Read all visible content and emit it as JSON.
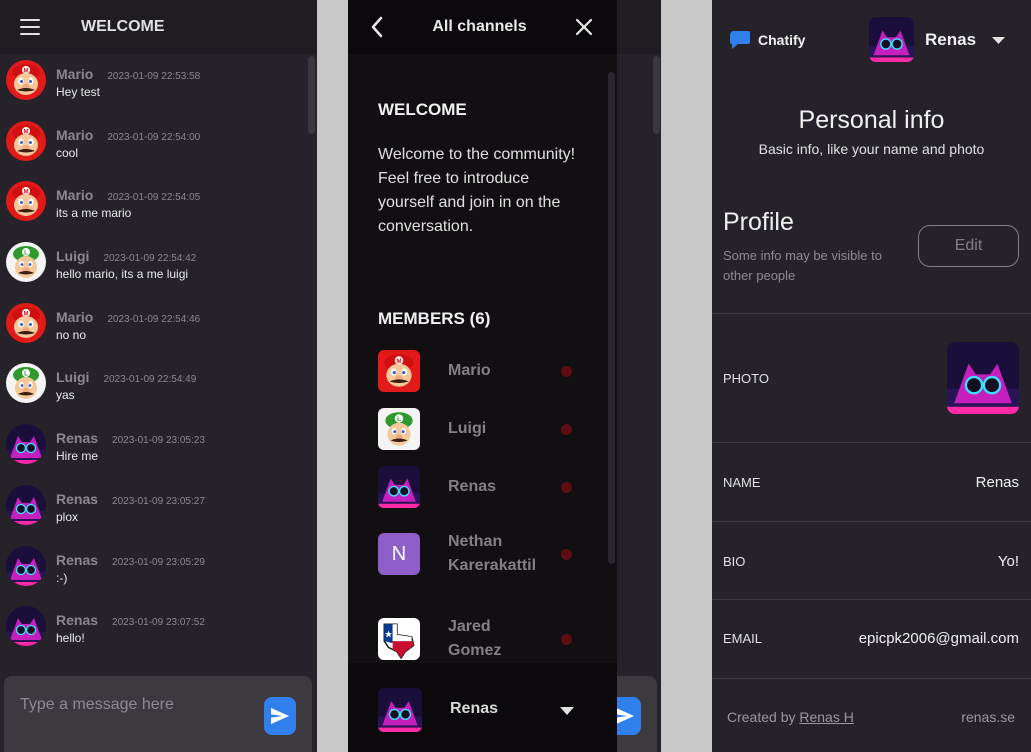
{
  "chat": {
    "channel_title": "WELCOME",
    "messages": [
      {
        "name": "Mario",
        "time": "2023-01-09 22:53:58",
        "text": "Hey test",
        "avatar": "mario"
      },
      {
        "name": "Mario",
        "time": "2023-01-09 22:54:00",
        "text": "cool",
        "avatar": "mario"
      },
      {
        "name": "Mario",
        "time": "2023-01-09 22:54:05",
        "text": "its a me mario",
        "avatar": "mario"
      },
      {
        "name": "Luigi",
        "time": "2023-01-09 22:54:42",
        "text": "hello mario, its a me luigi",
        "avatar": "luigi"
      },
      {
        "name": "Mario",
        "time": "2023-01-09 22:54:46",
        "text": "no no",
        "avatar": "mario"
      },
      {
        "name": "Luigi",
        "time": "2023-01-09 22:54:49",
        "text": "yas",
        "avatar": "luigi"
      },
      {
        "name": "Renas",
        "time": "2023-01-09 23:05:23",
        "text": "Hire me",
        "avatar": "renas"
      },
      {
        "name": "Renas",
        "time": "2023-01-09 23:05:27",
        "text": "plox",
        "avatar": "renas"
      },
      {
        "name": "Renas",
        "time": "2023-01-09 23:05:29",
        "text": ":-)",
        "avatar": "renas"
      },
      {
        "name": "Renas",
        "time": "2023-01-09 23:07:52",
        "text": "hello!",
        "avatar": "renas"
      }
    ],
    "composer": {
      "placeholder": "Type a message here"
    }
  },
  "drawer": {
    "title": "All channels",
    "channel_name": "WELCOME",
    "description": "Welcome to the community! Feel free to introduce yourself and join in on the conversation.",
    "members_heading": "MEMBERS (6)",
    "members": [
      {
        "name": "Mario",
        "avatar": "mario",
        "status": "offline"
      },
      {
        "name": "Luigi",
        "avatar": "luigi",
        "status": "offline"
      },
      {
        "name": "Renas",
        "avatar": "renas",
        "status": "offline"
      },
      {
        "name": "Nethan Karerakattil",
        "avatar": "letter",
        "letter": "N",
        "status": "offline"
      },
      {
        "name": "Jared Gomez",
        "avatar": "texas",
        "status": "offline"
      }
    ],
    "current_user": {
      "name": "Renas",
      "avatar": "renas"
    }
  },
  "profile": {
    "brand": "Chatify",
    "user": "Renas",
    "title": "Personal info",
    "subtitle": "Basic info, like your name and photo",
    "section": "Profile",
    "section_sub": "Some info may be visible to other people",
    "edit_label": "Edit",
    "fields": {
      "photo_label": "PHOTO",
      "name_label": "NAME",
      "name_value": "Renas",
      "bio_label": "BIO",
      "bio_value": "Yo!",
      "email_label": "EMAIL",
      "email_value": "epicpk2006@gmail.com"
    },
    "footer": {
      "created_by": "Created by",
      "author": "Renas H",
      "site": "renas.se"
    }
  },
  "colors": {
    "background": "#252329",
    "drawer": "#120f13",
    "accent": "#2f80ed",
    "status_offline": "#5c0e12",
    "avatar_letter_bg": "#8e5fc8"
  }
}
